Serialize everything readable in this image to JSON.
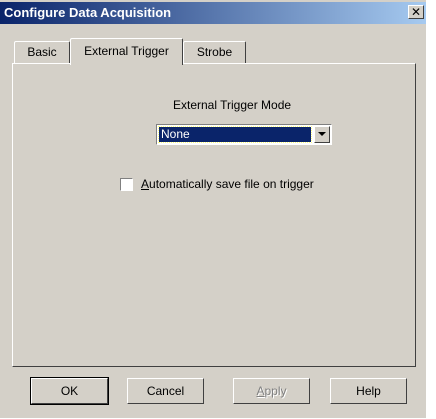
{
  "window": {
    "title": "Configure Data Acquisition",
    "close_label": "✕"
  },
  "tabs": [
    {
      "label": "Basic",
      "active": false
    },
    {
      "label": "External Trigger",
      "active": true
    },
    {
      "label": "Strobe",
      "active": false
    }
  ],
  "trigger": {
    "mode_label": "External Trigger Mode",
    "mode_value": "None"
  },
  "autosave": {
    "label_accel": "A",
    "label_rest": "utomatically save file on trigger",
    "checked": false
  },
  "buttons": {
    "ok": "OK",
    "cancel": "Cancel",
    "apply_accel": "A",
    "apply_rest": "pply",
    "help": "Help"
  }
}
